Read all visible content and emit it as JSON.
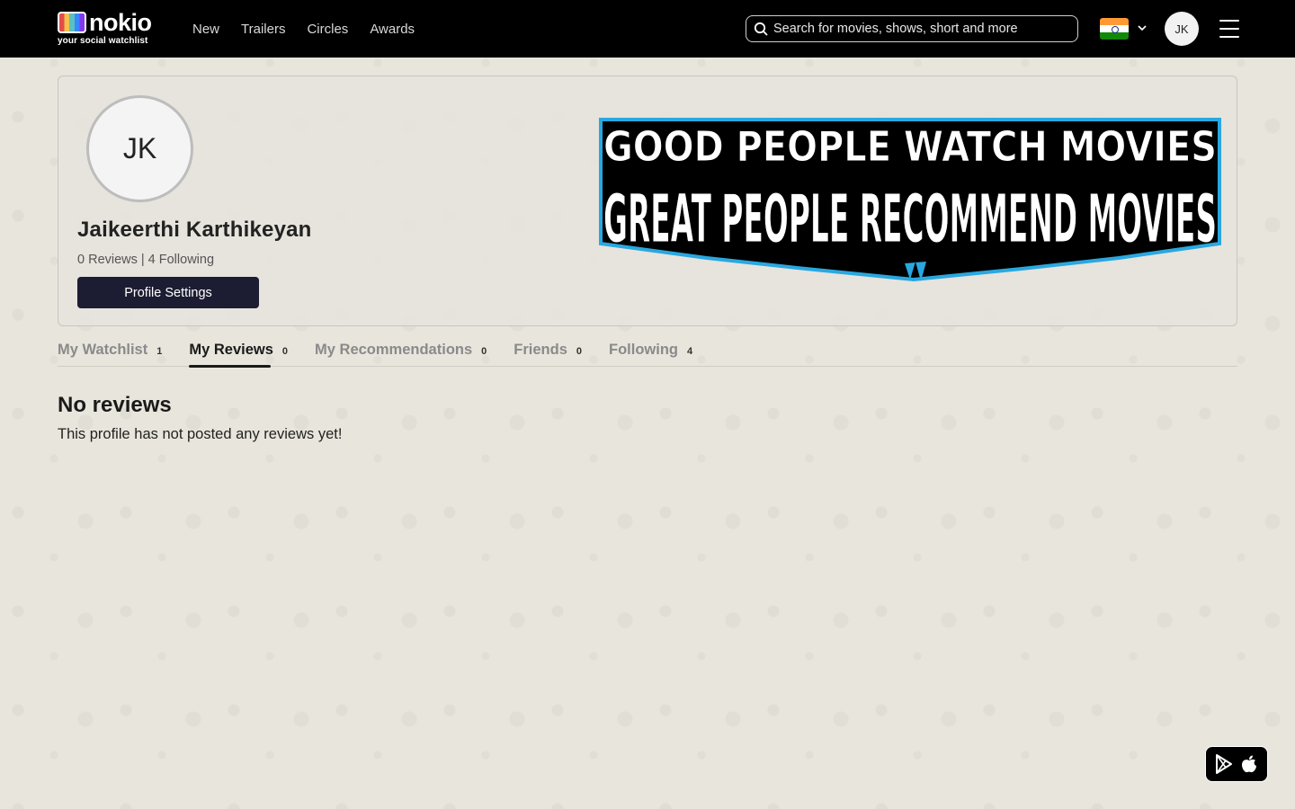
{
  "header": {
    "logo_word": "nokio",
    "logo_tagline": "your social watchlist",
    "nav": [
      "New",
      "Trailers",
      "Circles",
      "Awards"
    ],
    "search_placeholder": "Search for movies, shows, short and more",
    "user_initials": "JK"
  },
  "profile": {
    "initials": "JK",
    "name": "Jaikeerthi Karthikeyan",
    "reviews": "0 Reviews",
    "separator": "|",
    "following": "4 Following",
    "settings_label": "Profile Settings",
    "banner_line1": "GOOD PEOPLE WATCH MOVIES",
    "banner_line2": "GREAT PEOPLE RECOMMEND MOVIES"
  },
  "tabs": [
    {
      "label": "My Watchlist",
      "count": "1"
    },
    {
      "label": "My Reviews",
      "count": "0"
    },
    {
      "label": "My Recommendations",
      "count": "0"
    },
    {
      "label": "Friends",
      "count": "0"
    },
    {
      "label": "Following",
      "count": "4"
    }
  ],
  "empty_state": {
    "title": "No reviews",
    "text": "This profile has not posted any reviews yet!"
  },
  "colors": {
    "topbar": "#000000",
    "button": "#1c1c33",
    "banner_accent": "#29a8e0"
  }
}
